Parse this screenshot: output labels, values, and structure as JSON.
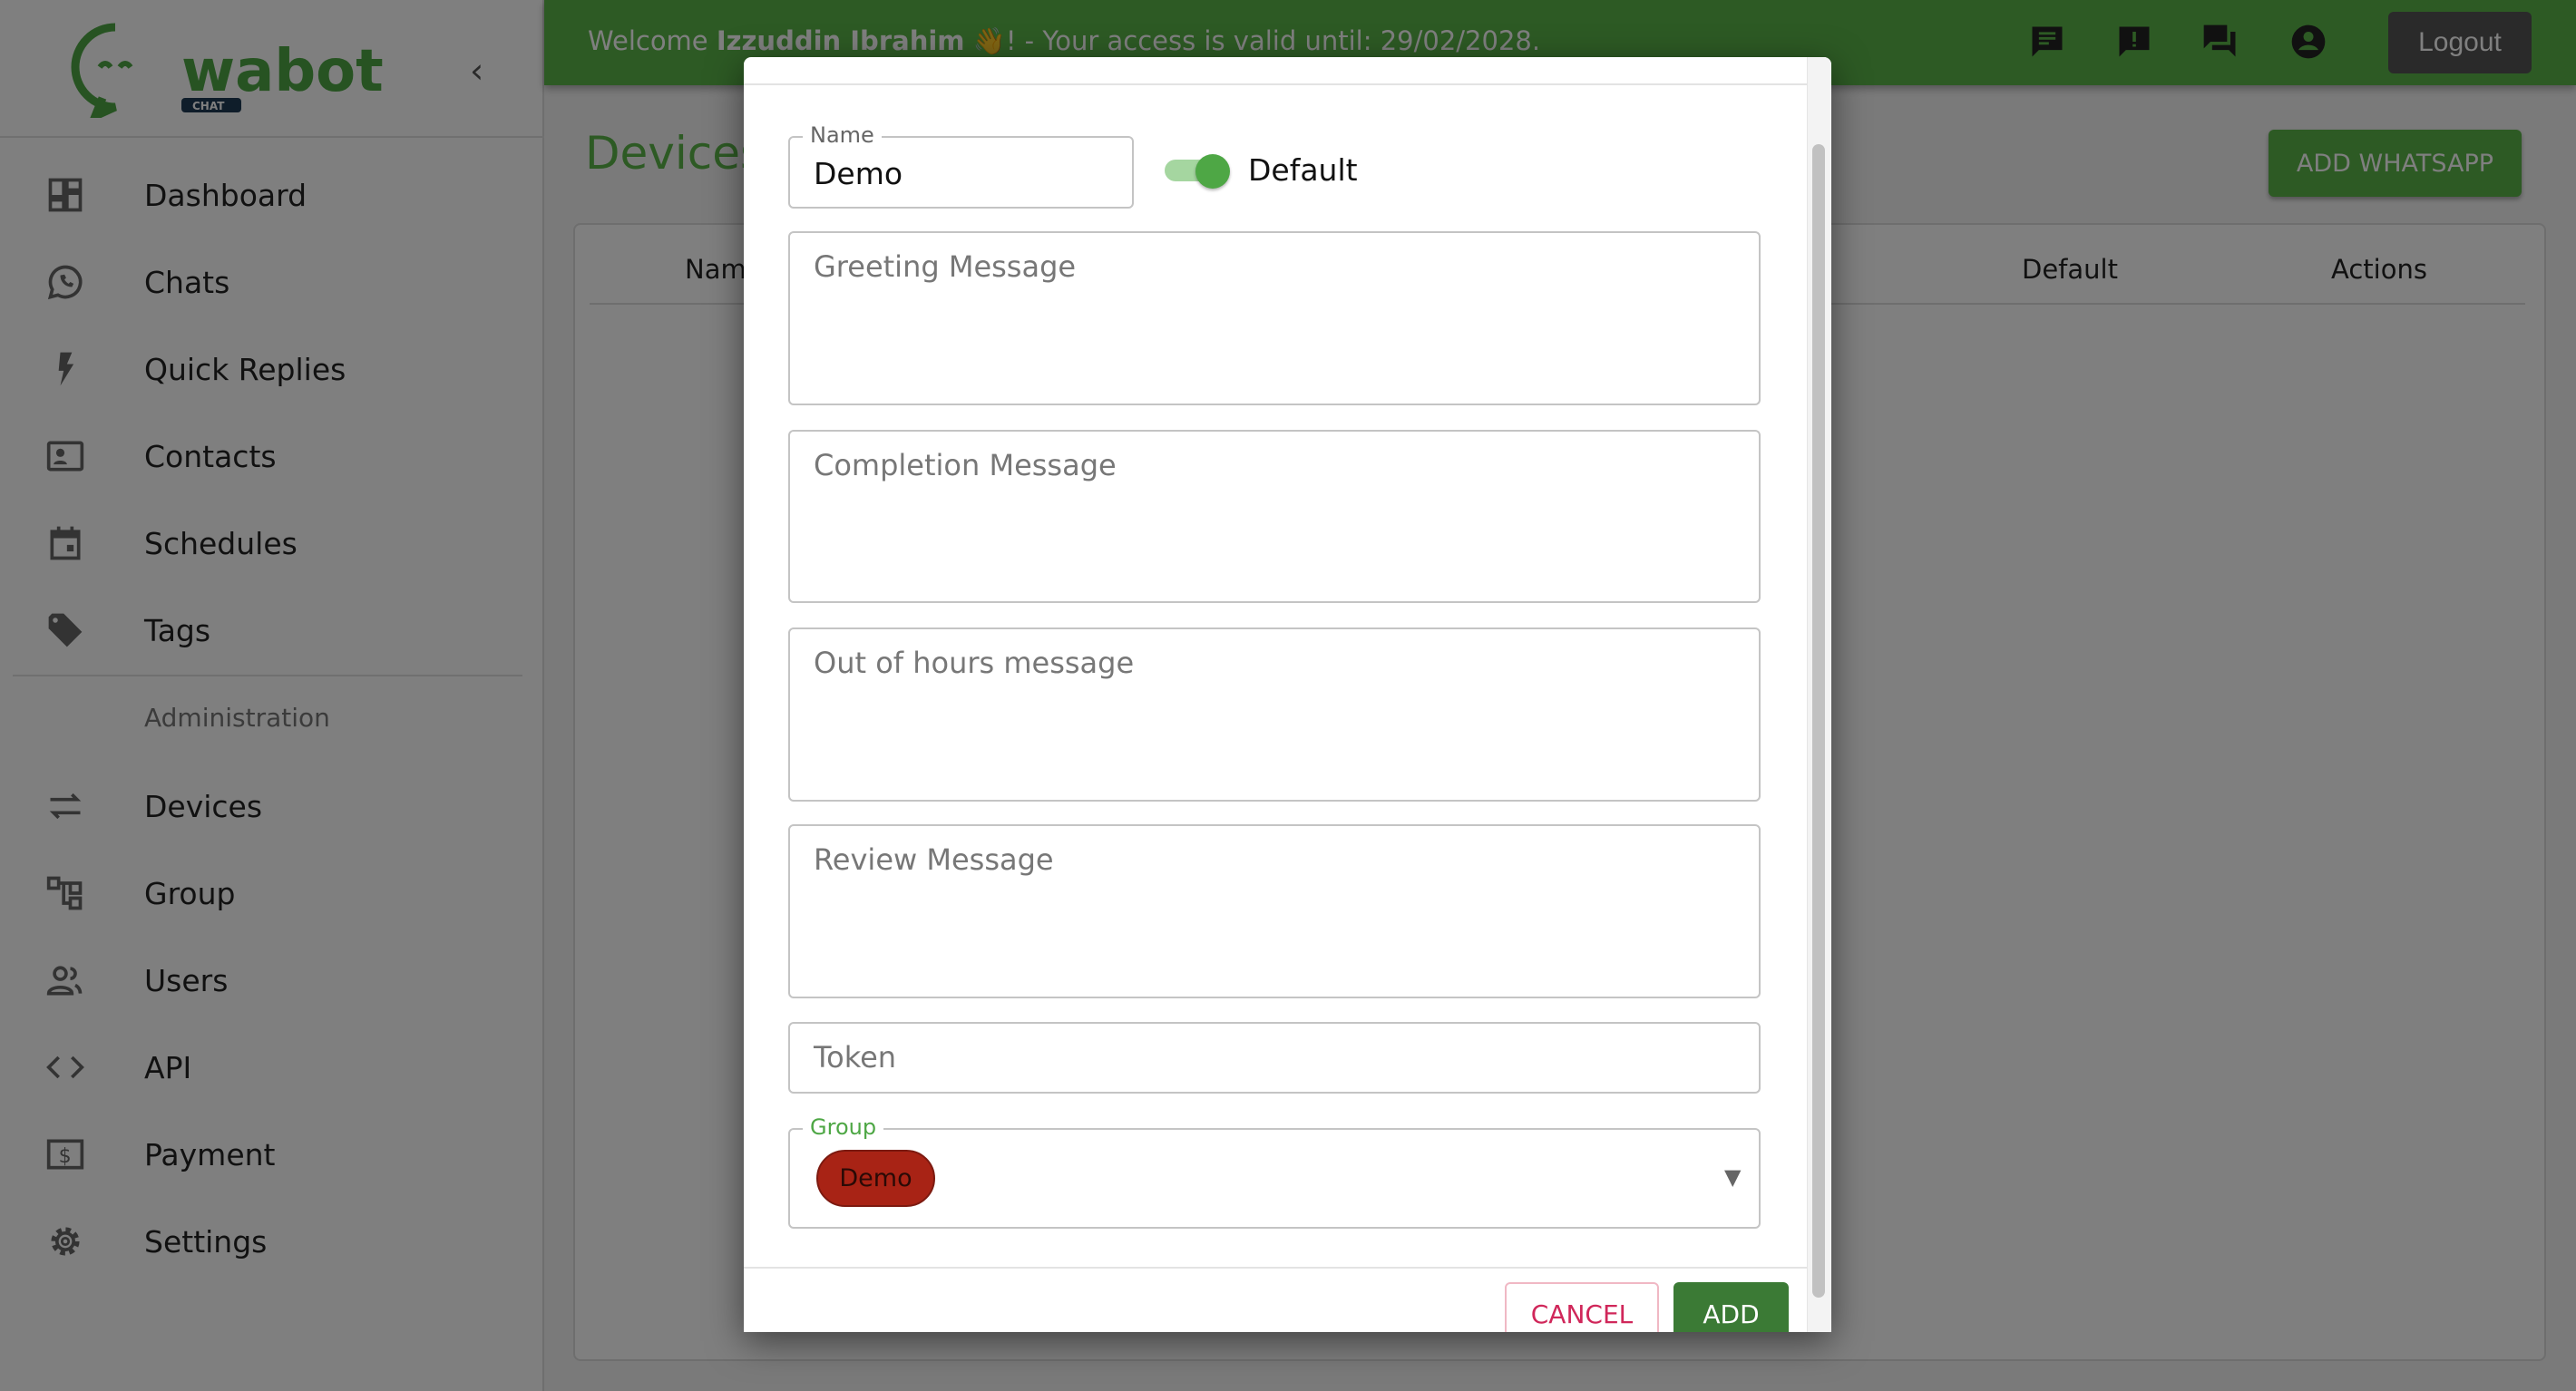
{
  "sidebar": {
    "logo_text": "wabot",
    "logo_sub": "CHAT",
    "items": [
      {
        "label": "Dashboard",
        "icon": "dashboard-icon"
      },
      {
        "label": "Chats",
        "icon": "whatsapp-icon"
      },
      {
        "label": "Quick Replies",
        "icon": "bolt-icon"
      },
      {
        "label": "Contacts",
        "icon": "contact-card-icon"
      },
      {
        "label": "Schedules",
        "icon": "calendar-icon"
      },
      {
        "label": "Tags",
        "icon": "tag-icon"
      }
    ],
    "section": "Administration",
    "admin_items": [
      {
        "label": "Devices",
        "icon": "swap-arrows-icon"
      },
      {
        "label": "Group",
        "icon": "hierarchy-icon"
      },
      {
        "label": "Users",
        "icon": "people-icon"
      },
      {
        "label": "API",
        "icon": "code-icon"
      },
      {
        "label": "Payment",
        "icon": "dollar-icon"
      },
      {
        "label": "Settings",
        "icon": "gear-icon"
      }
    ]
  },
  "header": {
    "welcome_prefix": "Welcome",
    "user_name": "Izzuddin Ibrahim",
    "wave": "👋",
    "access_text": "! - Your access is valid until: 29/02/2028.",
    "logout": "Logout",
    "brand_color": "#5ab448"
  },
  "main": {
    "title": "Devices",
    "add_button": "ADD WHATSAPP",
    "columns": [
      "Name",
      "Default",
      "Actions"
    ]
  },
  "modal": {
    "name_label": "Name",
    "name_value": "Demo",
    "default_label": "Default",
    "default_on": true,
    "greeting_placeholder": "Greeting Message",
    "completion_placeholder": "Completion Message",
    "out_of_hours_placeholder": "Out of hours message",
    "review_placeholder": "Review Message",
    "token_placeholder": "Token",
    "group_label": "Group",
    "group_selected": "Demo",
    "group_chip_color": "#a82315",
    "cancel": "CANCEL",
    "add": "ADD"
  }
}
